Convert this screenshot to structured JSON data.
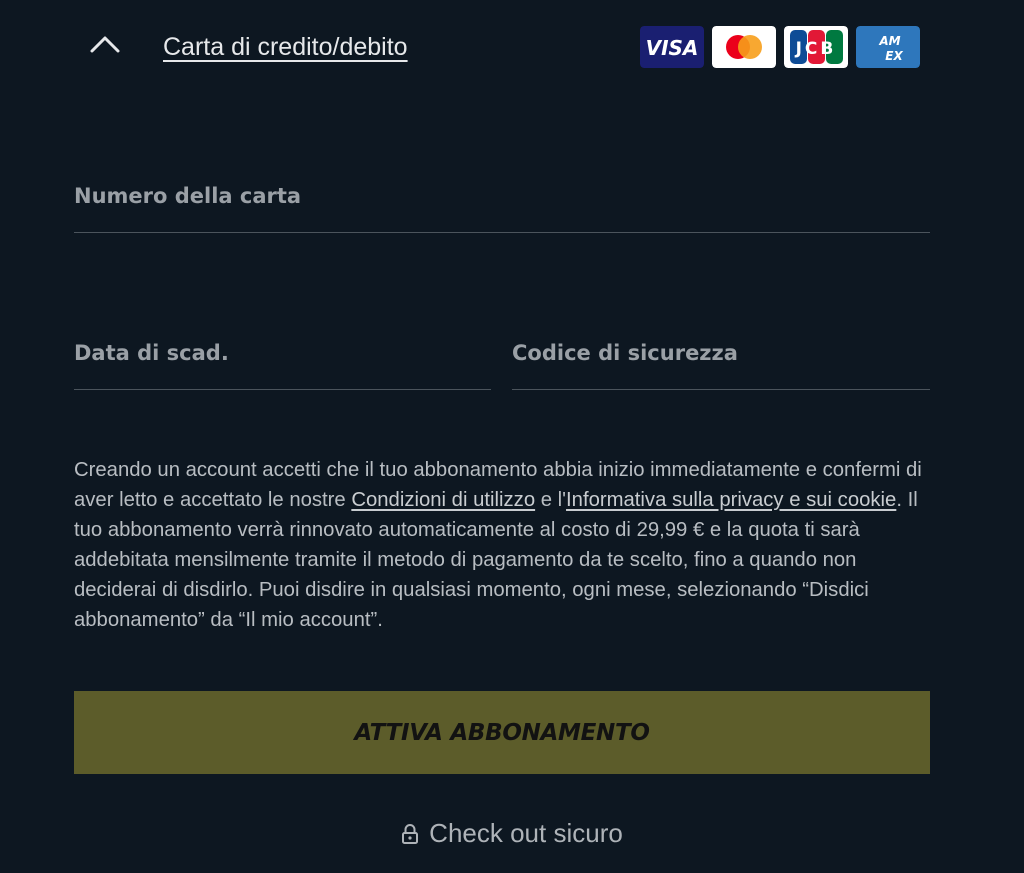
{
  "header": {
    "title": "Carta di credito/debito",
    "card_logos": [
      {
        "name": "visa",
        "text": "VISA",
        "color": "#1a1f71"
      },
      {
        "name": "mastercard",
        "colors": [
          "#eb001b",
          "#f79e1b"
        ]
      },
      {
        "name": "jcb",
        "text": "JCB",
        "colors": [
          "#0e4c96",
          "#e21836",
          "#007940"
        ]
      },
      {
        "name": "amex",
        "text": "AM EX",
        "color": "#2e77bc"
      }
    ]
  },
  "form": {
    "card_number_label": "Numero della carta",
    "card_number_value": "",
    "expiry_label": "Data di scad.",
    "expiry_value": "",
    "cvc_label": "Codice di sicurezza",
    "cvc_value": ""
  },
  "legal": {
    "part1": "Creando un account accetti che il tuo abbonamento abbia inizio immediatamente e confermi di aver letto e accettato le nostre ",
    "terms_link": "Condizioni di utilizzo",
    "part2": " e l'",
    "privacy_link": "Informativa sulla privacy e sui cookie",
    "part3": ". Il tuo abbonamento verrà rinnovato automaticamente al costo di 29,99 € e la quota ti sarà addebitata mensilmente tramite il metodo di pagamento da te scelto, fino a quando non deciderai di disdirlo. Puoi disdire in qualsiasi momento, ogni mese, selezionando “Disdici abbonamento” da “Il mio account”."
  },
  "cta": {
    "label": "ATTIVA ABBONAMENTO",
    "color": "#5c5c2a"
  },
  "secure": {
    "label": "Check out sicuro",
    "icon": "lock-icon"
  }
}
